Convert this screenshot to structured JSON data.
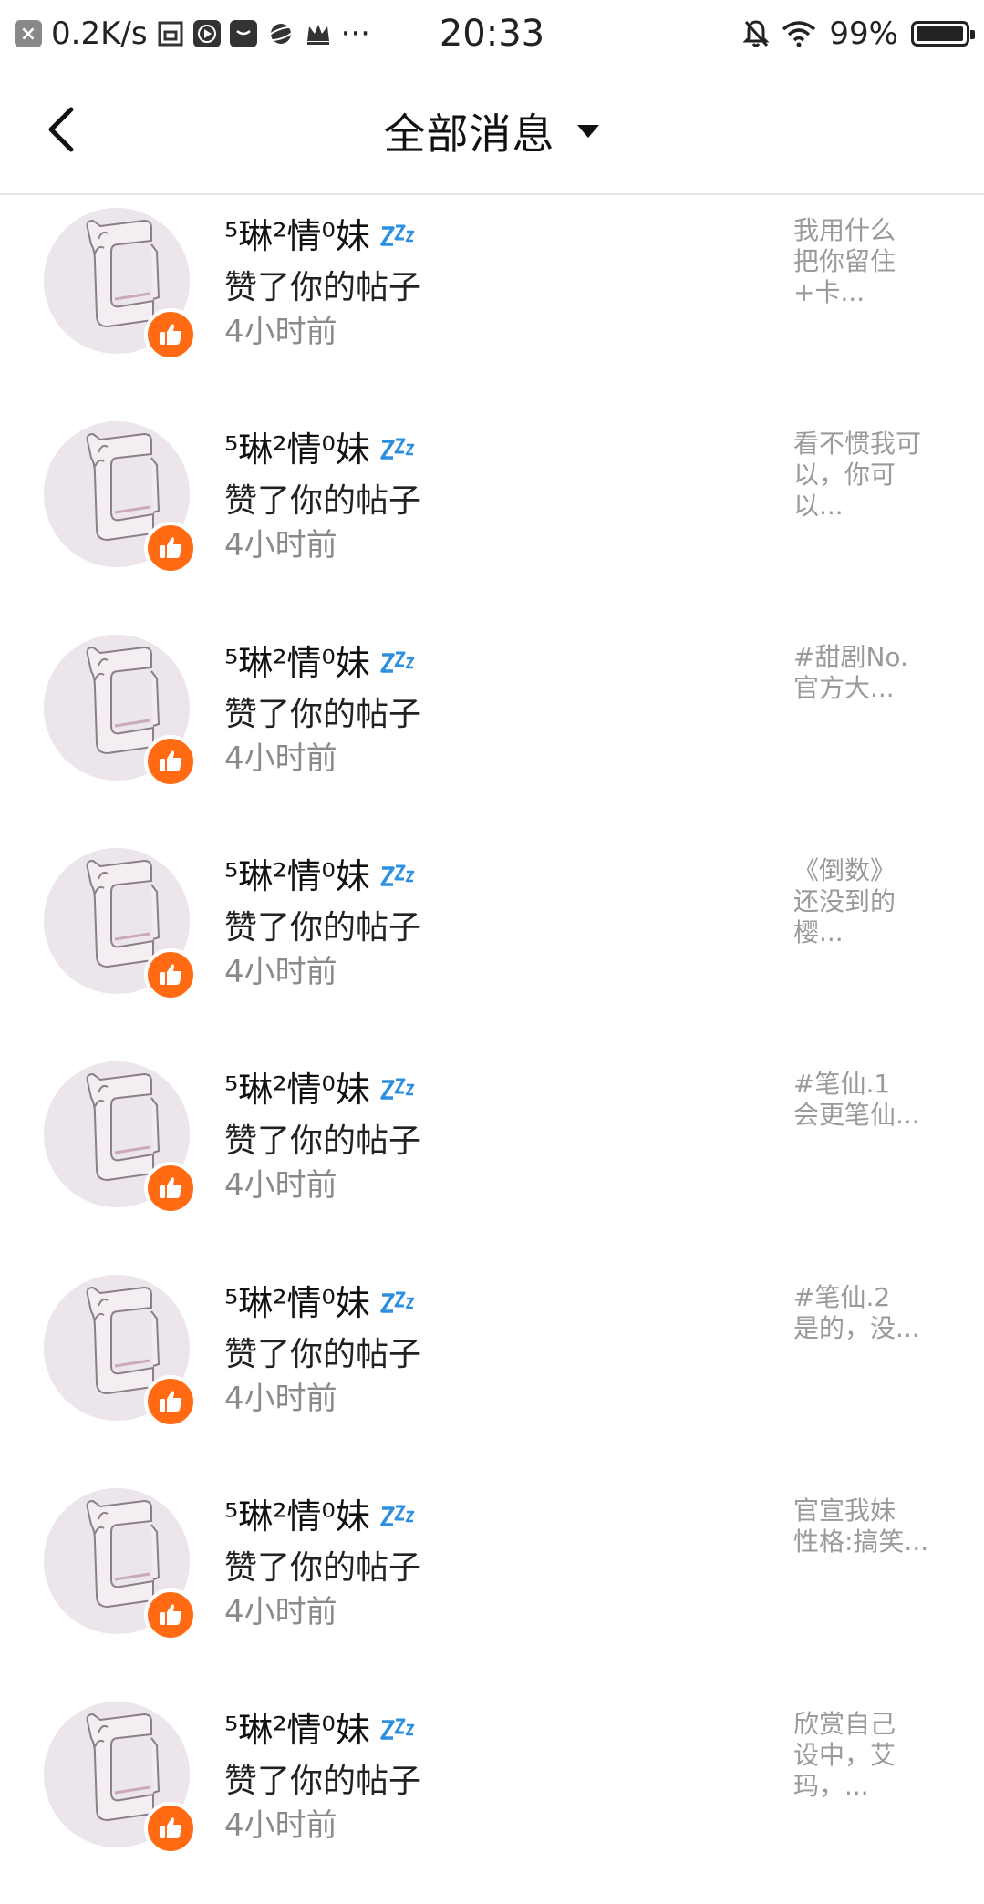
{
  "status_bar": {
    "net_speed": "0.2K/s",
    "time": "20:33",
    "battery": "99%",
    "more": "···",
    "battery_level": 0.99
  },
  "header": {
    "title": "全部消息"
  },
  "messages": [
    {
      "name": "⁵琳²情⁰妹",
      "action": "赞了你的帖子",
      "time": "4小时前",
      "preview": "我用什么\n把你留住\n+卡..."
    },
    {
      "name": "⁵琳²情⁰妹",
      "action": "赞了你的帖子",
      "time": "4小时前",
      "preview": "看不惯我可\n以，你可\n以..."
    },
    {
      "name": "⁵琳²情⁰妹",
      "action": "赞了你的帖子",
      "time": "4小时前",
      "preview": "#甜剧No.\n官方大..."
    },
    {
      "name": "⁵琳²情⁰妹",
      "action": "赞了你的帖子",
      "time": "4小时前",
      "preview": "《倒数》\n还没到的\n樱..."
    },
    {
      "name": "⁵琳²情⁰妹",
      "action": "赞了你的帖子",
      "time": "4小时前",
      "preview": "#笔仙.1\n会更笔仙..."
    },
    {
      "name": "⁵琳²情⁰妹",
      "action": "赞了你的帖子",
      "time": "4小时前",
      "preview": "#笔仙.2\n是的，没..."
    },
    {
      "name": "⁵琳²情⁰妹",
      "action": "赞了你的帖子",
      "time": "4小时前",
      "preview": "官宣我妹\n性格:搞笑..."
    },
    {
      "name": "⁵琳²情⁰妹",
      "action": "赞了你的帖子",
      "time": "4小时前",
      "preview": "欣赏自己\n设中，艾\n玛，..."
    }
  ],
  "colors": {
    "like_badge": "#ff6a13",
    "zzz_icon": "#2d8fe0",
    "avatar_bg": "#ece5ec"
  }
}
